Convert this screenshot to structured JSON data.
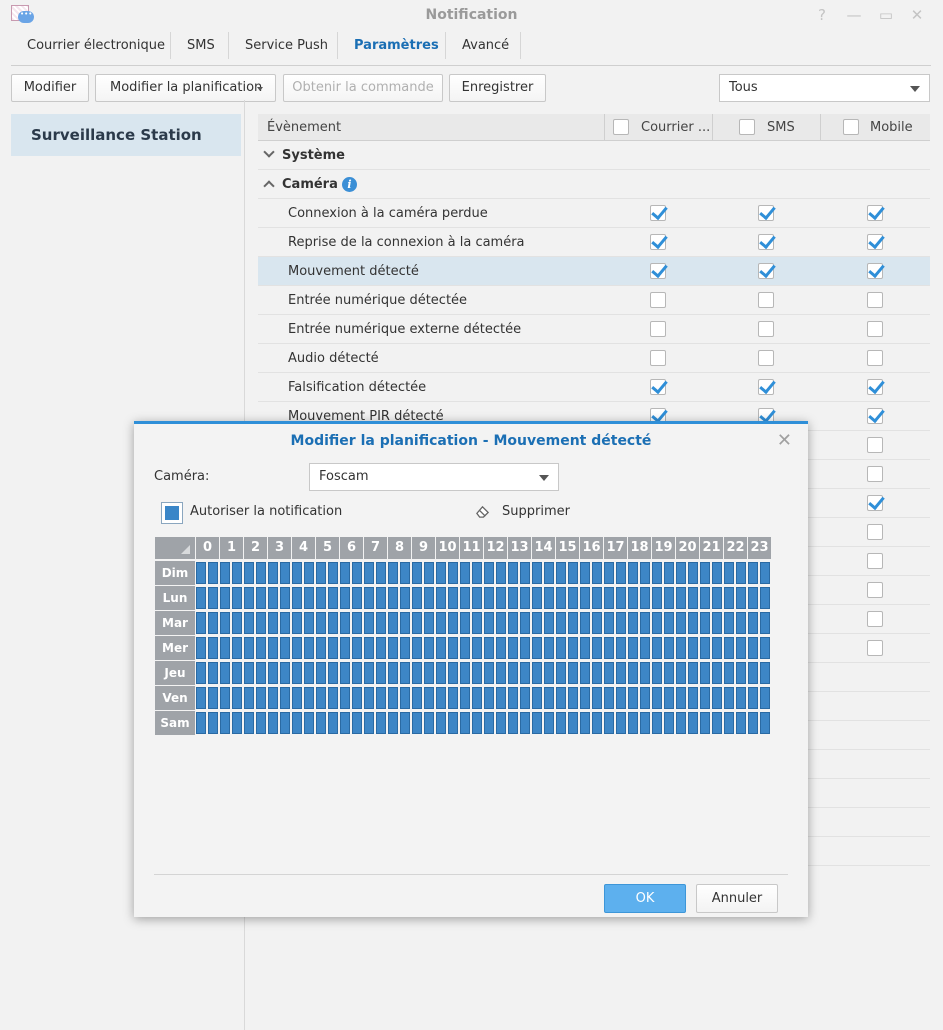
{
  "window": {
    "title": "Notification"
  },
  "tabs": [
    "Courrier électronique",
    "SMS",
    "Service Push",
    "Paramètres",
    "Avancé"
  ],
  "active_tab": "Paramètres",
  "toolbar": {
    "edit": "Modifier",
    "edit_schedule": "Modifier la planification",
    "get_command": "Obtenir la commande",
    "save": "Enregistrer",
    "filter_value": "Tous"
  },
  "sidebar": {
    "items": [
      "Surveillance Station"
    ]
  },
  "table": {
    "headers": {
      "event": "Évènement",
      "email": "Courrier ...",
      "sms": "SMS",
      "mobile": "Mobile"
    },
    "groups": [
      {
        "name": "Système",
        "expanded": false
      },
      {
        "name": "Caméra",
        "expanded": true
      }
    ],
    "rows": [
      {
        "event": "Connexion à la caméra perdue",
        "email": true,
        "sms": true,
        "mobile": true
      },
      {
        "event": "Reprise de la connexion à la caméra",
        "email": true,
        "sms": true,
        "mobile": true
      },
      {
        "event": "Mouvement détecté",
        "email": true,
        "sms": true,
        "mobile": true,
        "selected": true
      },
      {
        "event": "Entrée numérique détectée",
        "email": false,
        "sms": false,
        "mobile": false
      },
      {
        "event": "Entrée numérique externe détectée",
        "email": false,
        "sms": false,
        "mobile": false
      },
      {
        "event": "Audio détecté",
        "email": false,
        "sms": false,
        "mobile": false
      },
      {
        "event": "Falsification détectée",
        "email": true,
        "sms": true,
        "mobile": true
      },
      {
        "event": "Mouvement PIR détecté",
        "email": true,
        "sms": true,
        "mobile": true
      }
    ],
    "hidden_rows_mobile": [
      false,
      false,
      true,
      false,
      false,
      false,
      false,
      false
    ]
  },
  "modal": {
    "title": "Modifier la planification - Mouvement détecté",
    "camera_label": "Caméra:",
    "camera_value": "Foscam",
    "allow_label": "Autoriser la notification",
    "delete_label": "Supprimer",
    "hours": [
      "0",
      "1",
      "2",
      "3",
      "4",
      "5",
      "6",
      "7",
      "8",
      "9",
      "10",
      "11",
      "12",
      "13",
      "14",
      "15",
      "16",
      "17",
      "18",
      "19",
      "20",
      "21",
      "22",
      "23"
    ],
    "days": [
      "Dim",
      "Lun",
      "Mar",
      "Mer",
      "Jeu",
      "Ven",
      "Sam"
    ],
    "ok": "OK",
    "cancel": "Annuler"
  },
  "colors": {
    "accent": "#2f8fd8",
    "slot": "#3d86c6",
    "selected_row": "#d9e6ef"
  }
}
